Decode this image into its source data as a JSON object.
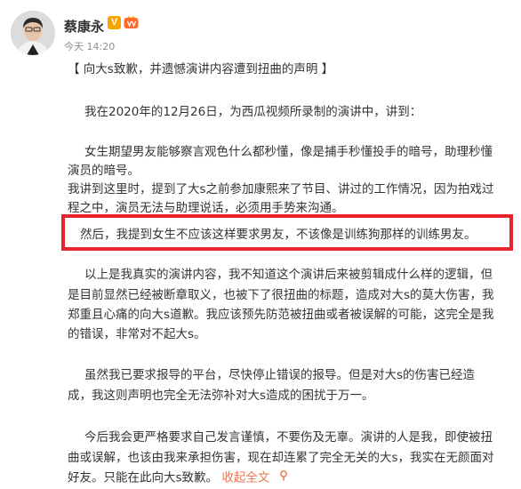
{
  "post": {
    "author": "蔡康永",
    "verified_mark": "V",
    "time": "今天 14:20",
    "title": "【 向大s致歉，并遗憾演讲内容遭到扭曲的声明 】",
    "p1": "我在2020年的12月26日，为西瓜视频所录制的演讲中，讲到：",
    "p2_line1": "女生期望男友能够察言观色什么都秒懂，像是捕手秒懂投手的暗号，助理秒懂",
    "p2_line2": "演员的暗号。",
    "p3_line1": "我讲到这里时，提到了大s之前参加康熙来了节目、讲过的工作情况，因为拍戏过",
    "p3_line2": "程之中，演员无法与助理说话，必须用手势来沟通。",
    "highlight": "然后，我提到女生不应该这样要求男友，不该像是训练狗那样的训练男友。",
    "p4_line1": "以上是我真实的演讲内容，我不知道这个演讲后来被剪辑成什么样的逻辑，但",
    "p4_line2": "是目前显然已经被断章取义，也被下了很扭曲的标题，造成对大s的莫大伤害，我",
    "p4_line3": "郑重且心痛的向大s道歉。我应该预先防范被扭曲或者被误解的可能，这完全是我",
    "p4_line4": "的错误，非常对不起大s。",
    "p5_line1": "虽然我已要求报导的平台，尽快停止错误的报导。但是对大s的伤害已经造",
    "p5_line2": "成，我这则声明也完全无法弥补对大s造成的困扰于万一。",
    "p6_line1": "今后我会更严格要求自己发言谨慎，不要伤及无辜。演讲的人是我，即使被扭",
    "p6_line2": "曲或误解，也该由我来承担伤害，现在却连累了完全无关的大s，我实在无颜面对",
    "p6_line3": "好友。只能在此向大s致歉。",
    "collapse_link": "收起全文",
    "collapse_icon": "pin-icon"
  },
  "colors": {
    "highlight_border": "#e8232c",
    "link": "#eb7350",
    "verify_badge": "#f8a400"
  }
}
